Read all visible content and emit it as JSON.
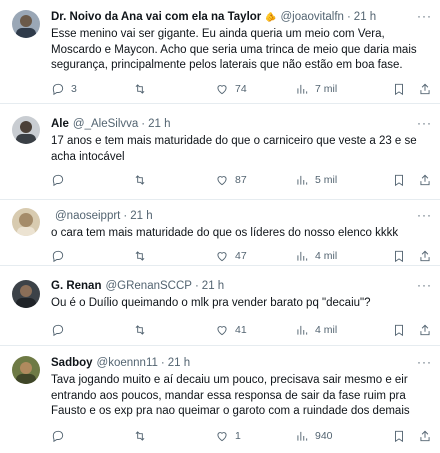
{
  "tweets": [
    {
      "name": "Dr. Noivo da Ana vai com ela na Taylor",
      "emoji": "🫵",
      "handle": "@joaovitalfn",
      "time": "21 h",
      "text": "Esse menino vai ser gigante. Eu ainda queria um meio com Vera, Moscardo e Maycon. Acho que seria uma trinca de meio que daria mais segurança, principalmente pelos laterais que não estão em boa fase.",
      "replies": "3",
      "retweets": "",
      "likes": "74",
      "views": "7 mil",
      "avatar_color": "#6b7a8f"
    },
    {
      "name": "Ale",
      "emoji": "",
      "handle": "@_AleSilvva",
      "time": "21 h",
      "text": "17 anos e tem mais maturidade do que o carniceiro que veste a 23 e se acha intocável",
      "replies": "",
      "retweets": "",
      "likes": "87",
      "views": "5 mil",
      "avatar_color": "#8a8f96"
    },
    {
      "name": "",
      "emoji": "",
      "handle": "@naoseipprt",
      "time": "21 h",
      "text": "o cara tem mais maturidade do que os líderes do nosso elenco kkkk",
      "replies": "",
      "retweets": "",
      "likes": "47",
      "views": "4 mil",
      "avatar_color": "#c7b79a"
    },
    {
      "name": "G. Renan",
      "emoji": "",
      "handle": "@GRenanSCCP",
      "time": "21 h",
      "text": "Ou é o Duílio queimando o mlk pra vender barato pq \"decaiu\"?",
      "replies": "",
      "retweets": "",
      "likes": "41",
      "views": "4 mil",
      "avatar_color": "#4a5056"
    },
    {
      "name": "Sadboy",
      "emoji": "",
      "handle": "@koennn11",
      "time": "21 h",
      "text": "Tava jogando muito e aí decaiu um pouco, precisava sair mesmo e eir entrando aos poucos, mandar essa responsa de sair da fase ruim pra Fausto e os exp pra nao queimar o garoto com a ruindade dos demais",
      "replies": "",
      "retweets": "",
      "likes": "1",
      "views": "940",
      "avatar_color": "#7c8a4e"
    }
  ]
}
